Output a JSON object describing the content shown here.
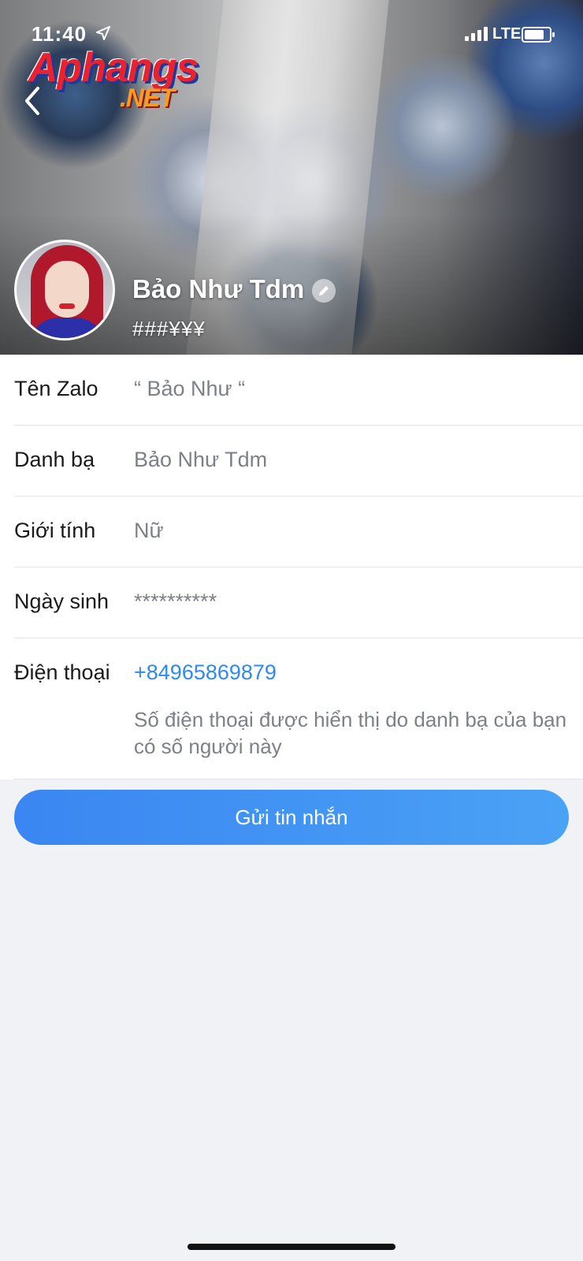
{
  "status_bar": {
    "time": "11:40",
    "network": "LTE"
  },
  "watermark": {
    "main": "Aphangs",
    "sub": ".NET"
  },
  "profile": {
    "name": "Bảo Như Tdm",
    "bio": "###¥¥¥"
  },
  "info": {
    "rows": [
      {
        "label": "Tên Zalo",
        "value": "“ Bảo Như “"
      },
      {
        "label": "Danh bạ",
        "value": "Bảo Như Tdm"
      },
      {
        "label": "Giới tính",
        "value": "Nữ"
      },
      {
        "label": "Ngày sinh",
        "value": "**********"
      }
    ],
    "phone": {
      "label": "Điện thoại",
      "value": "+84965869879",
      "note": "Số điện thoại được hiển thị do danh bạ của bạn có số người này"
    }
  },
  "actions": {
    "send_message_label": "Gửi tin nhắn"
  },
  "colors": {
    "accent": "#2f8af0",
    "button_start": "#3a86f2",
    "button_end": "#4aa2f5",
    "page_bg": "#f0f2f5"
  },
  "icons": [
    "location-arrow-icon",
    "signal-icon",
    "battery-icon",
    "back-chevron-icon",
    "edit-pencil-icon"
  ]
}
